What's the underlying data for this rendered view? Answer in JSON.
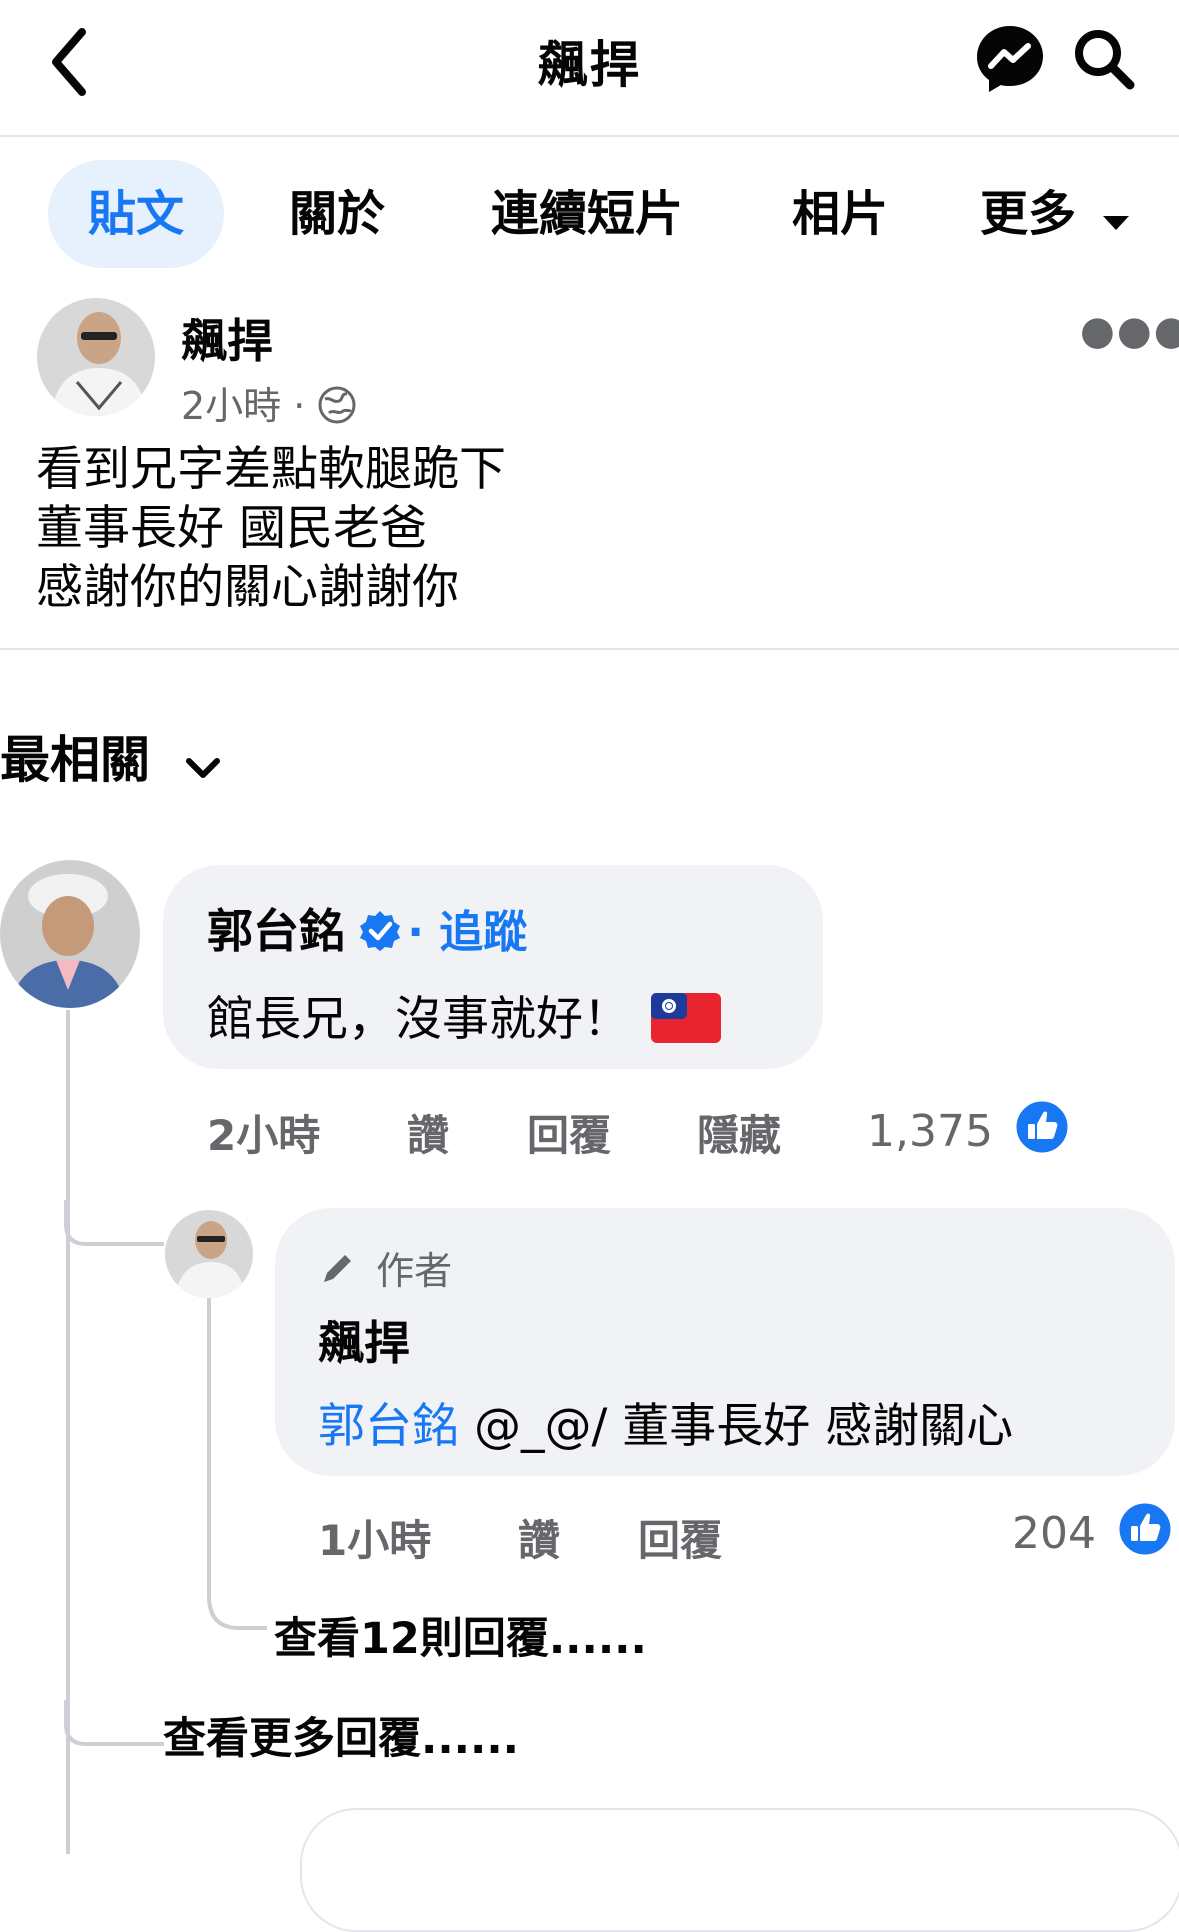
{
  "header": {
    "title": "飆捍"
  },
  "tabs": [
    {
      "label": "貼文"
    },
    {
      "label": "關於"
    },
    {
      "label": "連續短片"
    },
    {
      "label": "相片"
    },
    {
      "label": "更多"
    }
  ],
  "post": {
    "author": "飆捍",
    "time": "2小時",
    "body_lines": [
      "看到兄字差點軟腿跪下",
      "董事長好 國民老爸",
      "感謝你的關心謝謝你"
    ]
  },
  "sort": {
    "label": "最相關"
  },
  "comment": {
    "author": "郭台銘",
    "follow_label": "追蹤",
    "text": "館長兄，沒事就好！",
    "time": "2小時",
    "actions": {
      "like": "讚",
      "reply": "回覆",
      "hide": "隱藏"
    },
    "likes": "1,375"
  },
  "reply": {
    "author_tag": "作者",
    "author": "飆捍",
    "mention": "郭台銘",
    "text": " @_@/ 董事長好 感謝關心",
    "time": "1小時",
    "actions": {
      "like": "讚",
      "reply": "回覆"
    },
    "likes": "204"
  },
  "view_replies": "查看12則回覆......",
  "view_more_replies": "查看更多回覆......",
  "colors": {
    "accent": "#1877f2",
    "bubble": "#f0f2f5",
    "secondary_text": "#65676b"
  }
}
